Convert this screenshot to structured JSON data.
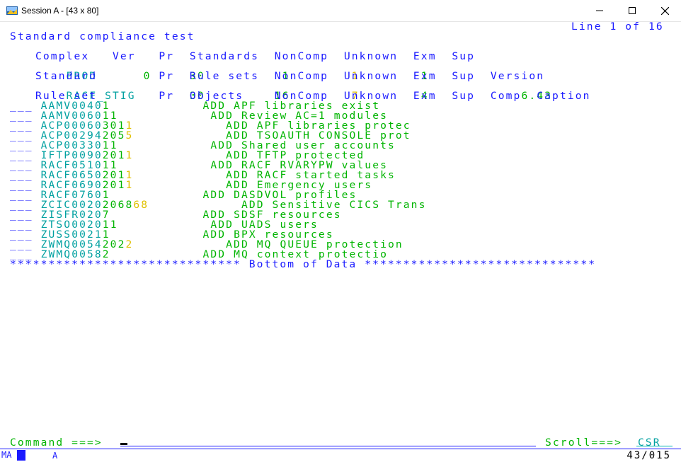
{
  "window": {
    "title": "Session A - [43 x 80]",
    "buttons": [
      "minimize",
      "maximize",
      "close"
    ]
  },
  "screen": {
    "title": "Standard compliance test",
    "line_info": "Line 1 of 16",
    "complex_header": "Complex   Ver   Pr  Standards  NonComp  Unknown  Exm  Sup",
    "complex_row": "PROD      0     30          1        1        1",
    "standard_header": "Standard        Pr  Rule sets  NonComp  Unknown  Exm  Sup  Version",
    "standard_row": "RACF_STIG       30         16        7        4            6.43",
    "ruleset_header": "Rule set        Pr  Objects    NonComp  Unknown  Exm  Sup  Comp  Caption",
    "rows": [
      {
        "prefix": "___",
        "name": "AAMV0040",
        "pr": "",
        "objects": "1",
        "noncomp": "",
        "unknown": "",
        "comp": "ADD",
        "caption": "APF libraries exist"
      },
      {
        "prefix": "___",
        "name": "AAMV0060",
        "pr": "",
        "objects": "1",
        "noncomp": "",
        "unknown": "1",
        "comp": "ADD",
        "caption": "Review AC=1 modules"
      },
      {
        "prefix": "___",
        "name": "ACP00060",
        "pr": "30",
        "objects": "1",
        "noncomp": "1",
        "unknown": "",
        "comp": "ADD",
        "caption": "APF libraries protec"
      },
      {
        "prefix": "___",
        "name": "ACP00294",
        "pr": "20",
        "objects": "5",
        "noncomp": "5",
        "unknown": "",
        "comp": "ADD",
        "caption": "TSOAUTH CONSOLE prot"
      },
      {
        "prefix": "___",
        "name": "ACP00330",
        "pr": "",
        "objects": "1",
        "noncomp": "",
        "unknown": "1",
        "comp": "ADD",
        "caption": "Shared user accounts"
      },
      {
        "prefix": "___",
        "name": "IFTP0090",
        "pr": "20",
        "objects": "1",
        "noncomp": "1",
        "unknown": "",
        "comp": "ADD",
        "caption": "TFTP protected"
      },
      {
        "prefix": "___",
        "name": "RACF0510",
        "pr": "",
        "objects": "1",
        "noncomp": "",
        "unknown": "1",
        "comp": "ADD",
        "caption": "RACF RVARYPW values"
      },
      {
        "prefix": "___",
        "name": "RACF0650",
        "pr": "20",
        "objects": "1",
        "noncomp": "1",
        "unknown": "",
        "comp": "ADD",
        "caption": "RACF started tasks"
      },
      {
        "prefix": "___",
        "name": "RACF0690",
        "pr": "20",
        "objects": "1",
        "noncomp": "1",
        "unknown": "",
        "comp": "ADD",
        "caption": "Emergency users"
      },
      {
        "prefix": "___",
        "name": "RACF0760",
        "pr": "",
        "objects": "1",
        "noncomp": "",
        "unknown": "",
        "comp": "ADD",
        "caption": "DASDVOL profiles"
      },
      {
        "prefix": "___",
        "name": "ZCIC0020",
        "pr": "20",
        "objects": "68",
        "noncomp": "68",
        "unknown": "",
        "comp": "ADD",
        "caption": "Sensitive CICS Trans"
      },
      {
        "prefix": "___",
        "name": "ZISFR020",
        "pr": "",
        "objects": "7",
        "noncomp": "",
        "unknown": "",
        "comp": "ADD",
        "caption": "SDSF resources"
      },
      {
        "prefix": "___",
        "name": "ZTSO0020",
        "pr": "",
        "objects": "1",
        "noncomp": "",
        "unknown": "1",
        "comp": "ADD",
        "caption": "UADS users"
      },
      {
        "prefix": "___",
        "name": "ZUSS0021",
        "pr": "",
        "objects": "1",
        "noncomp": "",
        "unknown": "",
        "comp": "ADD",
        "caption": "BPX resources"
      },
      {
        "prefix": "___",
        "name": "ZWMQ0054",
        "pr": "20",
        "objects": "2",
        "noncomp": "2",
        "unknown": "",
        "comp": "ADD",
        "caption": "MQ QUEUE protection"
      },
      {
        "prefix": "___",
        "name": "ZWMQ0058",
        "pr": "",
        "objects": "2",
        "noncomp": "",
        "unknown": "",
        "comp": "ADD",
        "caption": "MQ context protectio"
      }
    ],
    "bottom_marker": "****************************** Bottom of Data ******************************",
    "command_label": "Command ===>",
    "command_value": "",
    "scroll_label": "Scroll===>",
    "scroll_value": "CSR"
  },
  "status": {
    "left": "MA",
    "indicator": "A",
    "position": "43/015"
  },
  "colors": {
    "header_blue": "#1a1aff",
    "field_cyan": "#00a0a0",
    "value_green": "#00b400",
    "noncomp_yellow": "#e0c000"
  }
}
